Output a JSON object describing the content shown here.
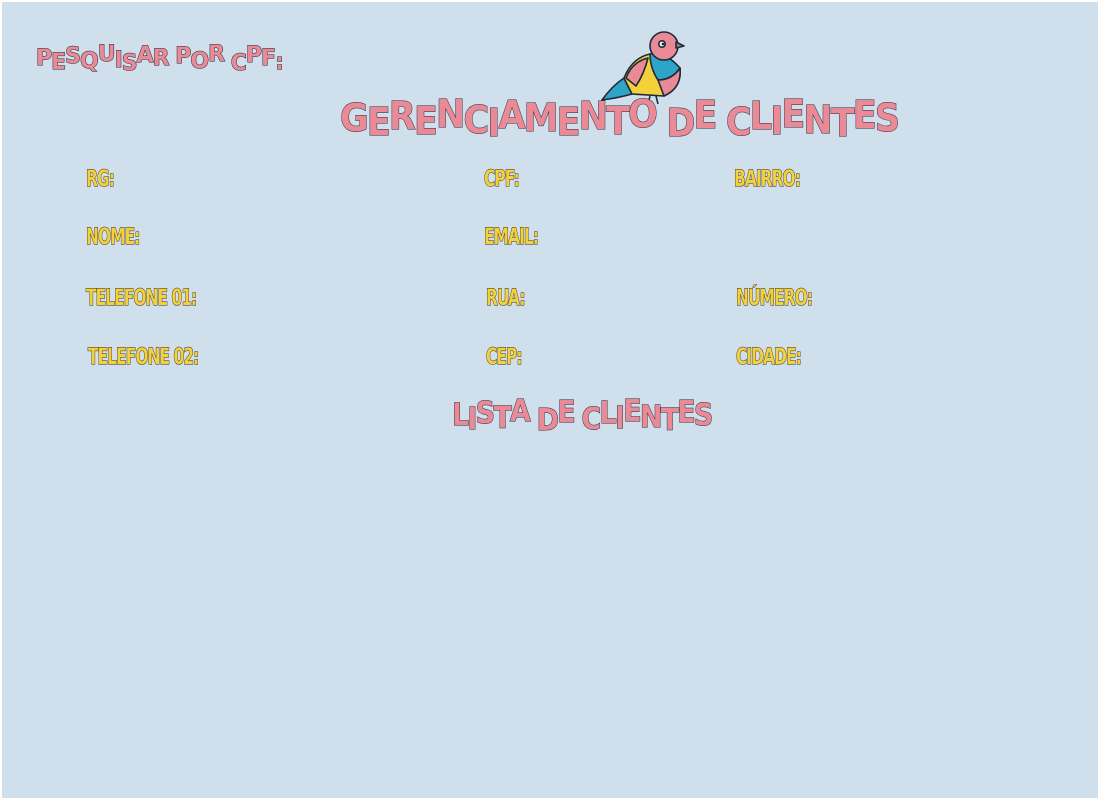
{
  "palette": {
    "background": "#d0dfec",
    "pink": "#ea8a96",
    "blue": "#2ea4c8",
    "yellow": "#f4d03a",
    "outline": "#1e2a3a"
  },
  "search": {
    "label": "PESQUISAR POR CPF:"
  },
  "header": {
    "title": "GERENCIAMENTO DE CLIENTES",
    "mascot_icon": "bird-icon"
  },
  "form": {
    "rg": "RG:",
    "cpf": "CPF:",
    "bairro": "BAIRRO:",
    "nome": "NOME:",
    "email": "EMAIL:",
    "telefone1": "TELEFONE 01:",
    "rua": "RUA:",
    "numero": "NÚMERO:",
    "telefone2": "TELEFONE 02:",
    "cep": "CEP:",
    "cidade": "CIDADE:"
  },
  "list": {
    "title": "LISTA DE CLIENTES",
    "rows": []
  }
}
